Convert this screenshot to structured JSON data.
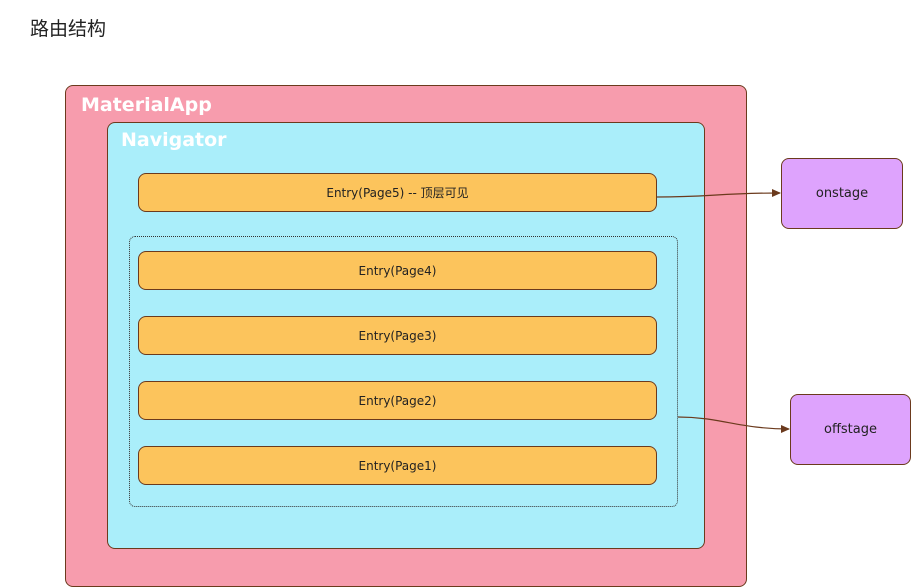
{
  "heading": "路由结构",
  "material_app": {
    "title": "MaterialApp"
  },
  "navigator": {
    "title": "Navigator"
  },
  "entries": {
    "top": "Entry(Page5)  -- 顶层可见",
    "page4": "Entry(Page4)",
    "page3": "Entry(Page3)",
    "page2": "Entry(Page2)",
    "page1": "Entry(Page1)"
  },
  "stages": {
    "onstage": "onstage",
    "offstage": "offstage"
  },
  "colors": {
    "material_app": "#f79cad",
    "navigator": "#aaeefa",
    "entry": "#fcc45c",
    "stage": "#dea3fd",
    "connector": "#6b3a1d"
  }
}
